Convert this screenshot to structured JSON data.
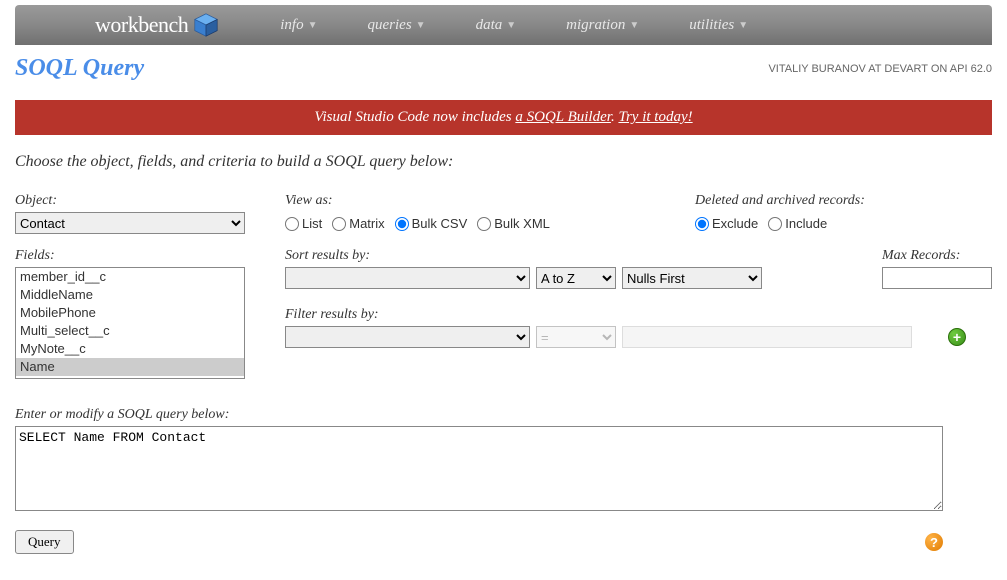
{
  "logo_text": "workbench",
  "nav": [
    "info",
    "queries",
    "data",
    "migration",
    "utilities"
  ],
  "page_title": "SOQL Query",
  "user_info": "VITALIY BURANOV AT DEVART ON API 62.0",
  "banner": {
    "prefix": "Visual Studio Code now includes ",
    "link1": "a SOQL Builder",
    "mid": ". ",
    "link2": "Try it today!"
  },
  "subtitle": "Choose the object, fields, and criteria to build a SOQL query below:",
  "labels": {
    "object": "Object:",
    "view_as": "View as:",
    "deleted": "Deleted and archived records:",
    "fields": "Fields:",
    "sort_by": "Sort results by:",
    "max_records": "Max Records:",
    "filter_by": "Filter results by:",
    "query_label": "Enter or modify a SOQL query below:"
  },
  "object_selected": "Contact",
  "view_as_options": [
    "List",
    "Matrix",
    "Bulk CSV",
    "Bulk XML"
  ],
  "view_as_selected": "Bulk CSV",
  "deleted_options": [
    "Exclude",
    "Include"
  ],
  "deleted_selected": "Exclude",
  "fields_visible": [
    "member_id__c",
    "MiddleName",
    "MobilePhone",
    "Multi_select__c",
    "MyNote__c",
    "Name"
  ],
  "fields_selected": "Name",
  "sort_direction": "A to Z",
  "sort_nulls": "Nulls First",
  "filter_op": "=",
  "query_text": "SELECT Name FROM Contact",
  "query_button": "Query"
}
